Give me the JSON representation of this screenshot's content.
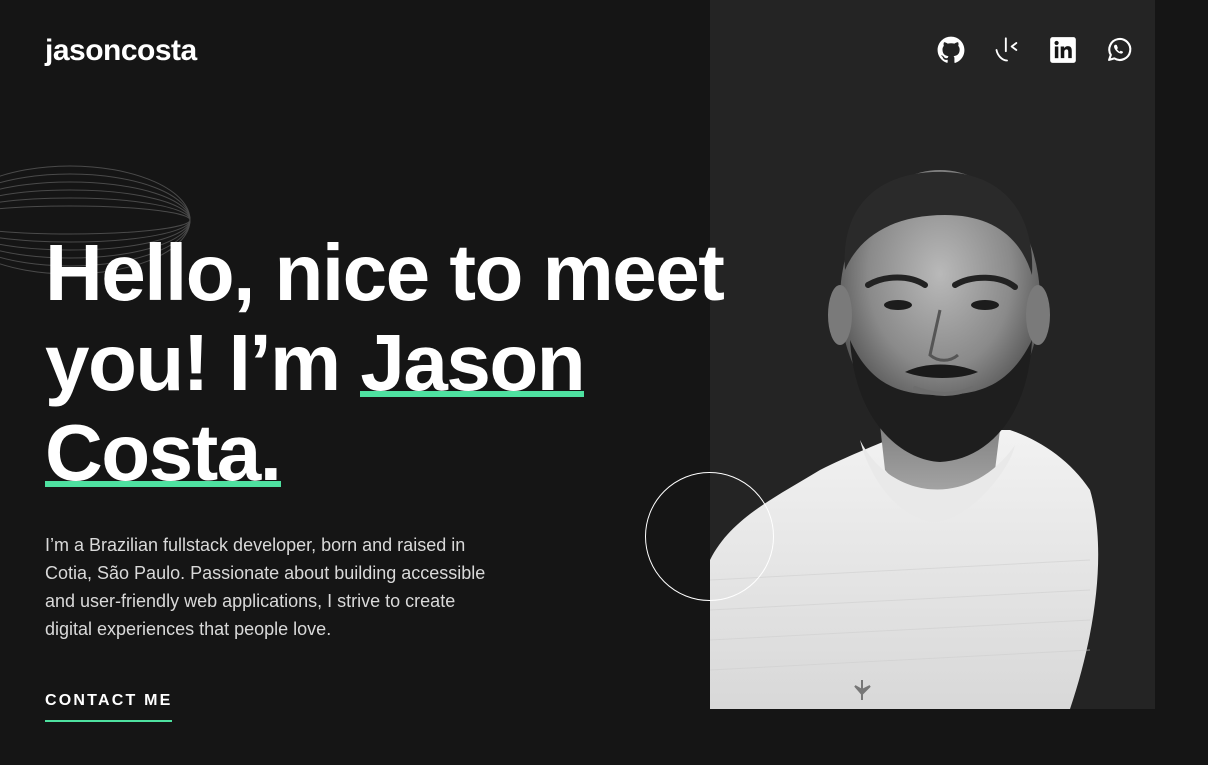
{
  "header": {
    "brand": "jasoncosta",
    "socials": [
      {
        "name": "github",
        "icon": "github-icon"
      },
      {
        "name": "frontend-mentor",
        "icon": "frontend-mentor-icon"
      },
      {
        "name": "linkedin",
        "icon": "linkedin-icon"
      },
      {
        "name": "whatsapp",
        "icon": "whatsapp-icon"
      }
    ]
  },
  "hero": {
    "heading_part1": "Hello, nice to meet you! I’m ",
    "heading_name_first": "Jason",
    "heading_space": " ",
    "heading_name_last": "Costa.",
    "intro": "I’m a Brazilian fullstack developer, born and raised in Cotia, São Paulo. Passionate about building accessible and user-friendly web applications, I strive to create digital experiences that people love.",
    "contact_label": "CONTACT ME"
  },
  "colors": {
    "background": "#151515",
    "panel": "#242424",
    "accent": "#4ee1a0",
    "text": "#ffffff",
    "body_text": "#d9d9d9"
  }
}
